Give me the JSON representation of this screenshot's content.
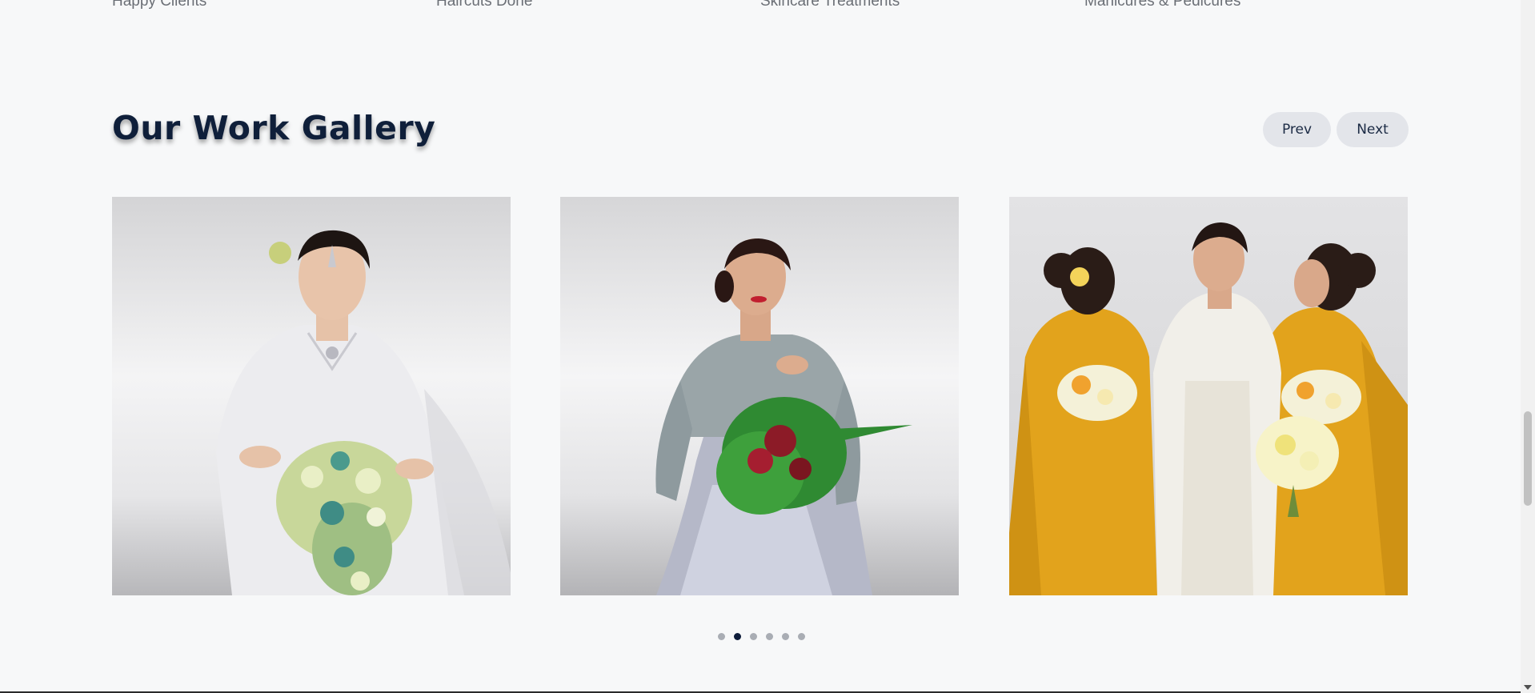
{
  "stats": {
    "labels": [
      "Happy Clients",
      "Haircuts Done",
      "Skincare Treatments",
      "Manicures & Pedicures"
    ]
  },
  "gallery": {
    "title": "Our Work Gallery",
    "prev_label": "Prev",
    "next_label": "Next",
    "slide_count": 6,
    "active_slide": 2
  },
  "colors": {
    "background": "#f7f8f9",
    "title": "#0f1f3a",
    "button_bg": "#e3e5ea",
    "dot_active": "#0e1d3a",
    "dot_inactive": "#a9adb4",
    "saree_yellow": "#e2a31c"
  }
}
